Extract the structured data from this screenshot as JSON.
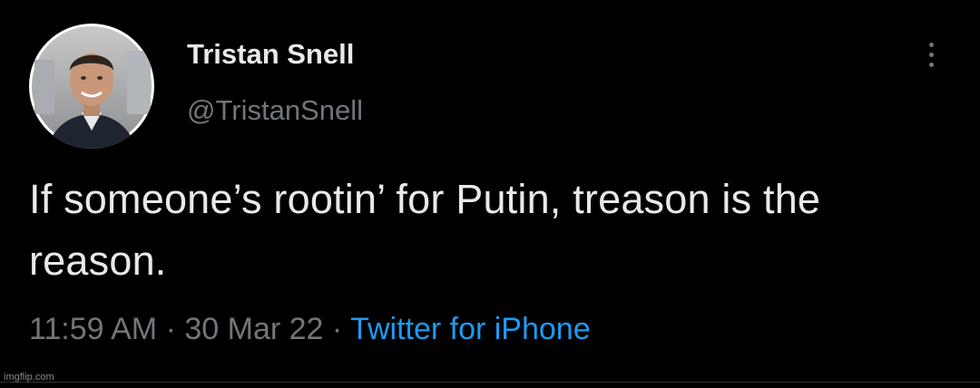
{
  "tweet": {
    "display_name": "Tristan Snell",
    "handle": "@TristanSnell",
    "text": "If someone’s rootin’ for Putin, treason is the reason.",
    "time": "11:59 AM",
    "sep1": " · ",
    "date": "30 Mar 22",
    "sep2": " · ",
    "source": "Twitter for iPhone"
  },
  "icons": {
    "more": "more-vertical-icon",
    "avatar": "profile-photo"
  },
  "watermark": "imgflip.com",
  "colors": {
    "background": "#000000",
    "primary_text": "#e7e9ea",
    "secondary_text": "#71767b",
    "link": "#1d9bf0"
  }
}
